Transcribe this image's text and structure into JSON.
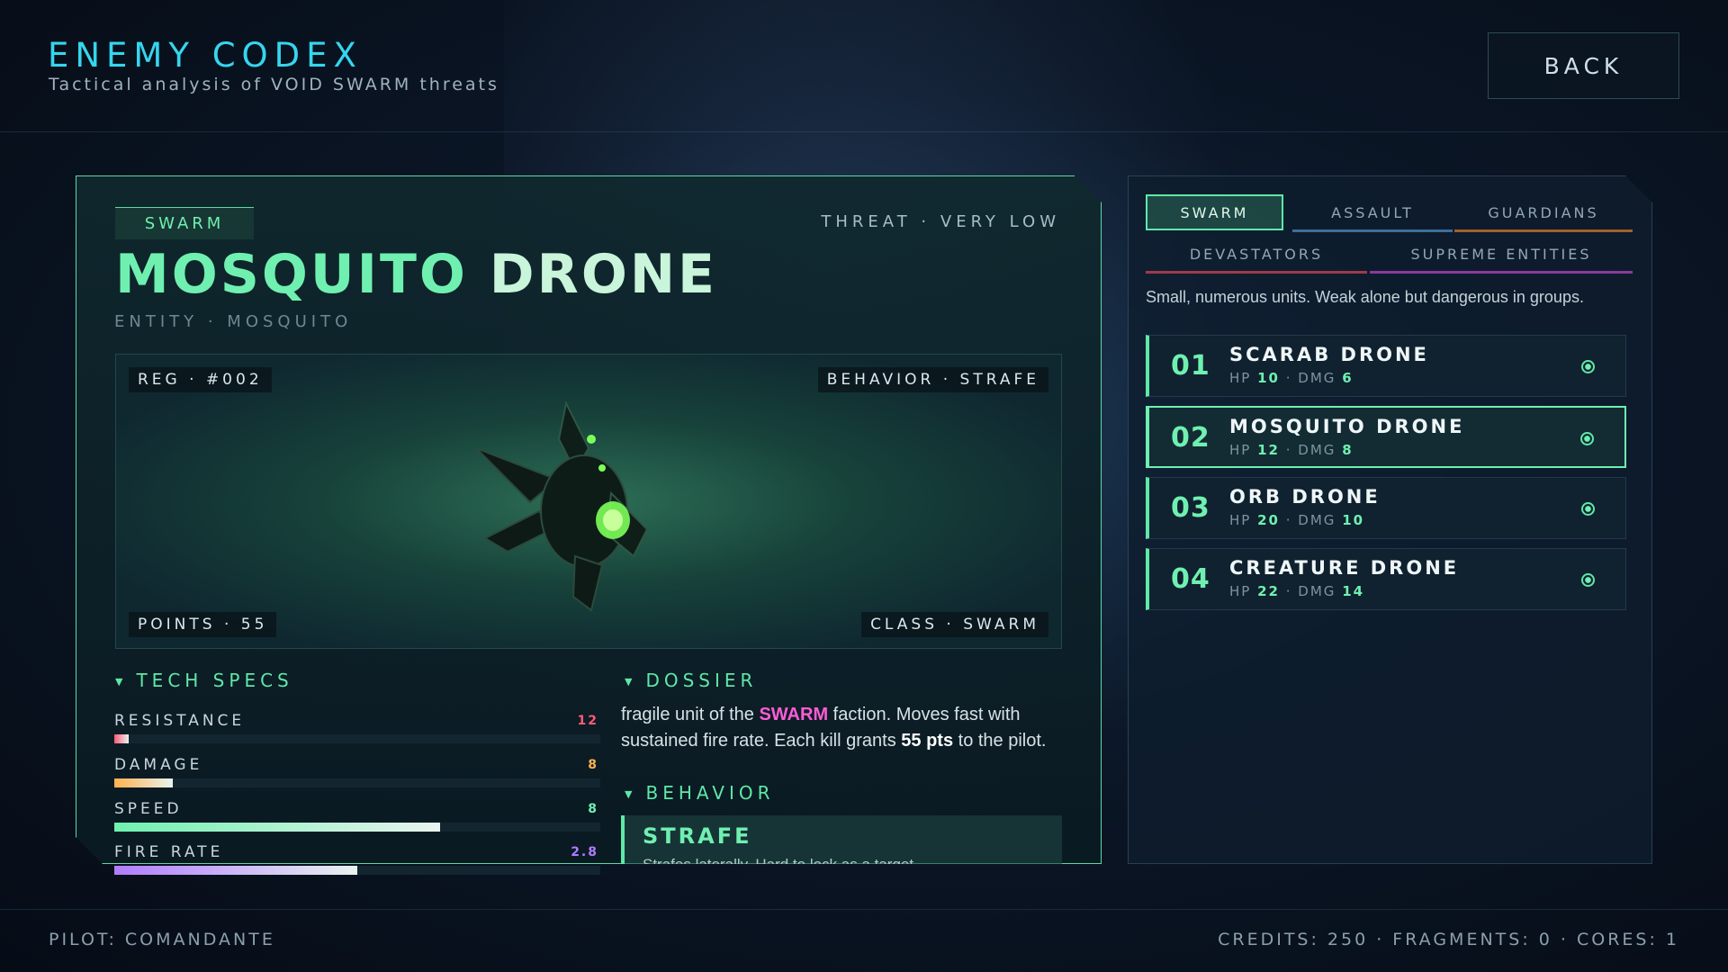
{
  "header": {
    "title": "ENEMY CODEX",
    "subtitle": "Tactical analysis of VOID SWARM threats",
    "back_label": "BACK"
  },
  "detail": {
    "faction": "SWARM",
    "threat": "THREAT · VERY LOW",
    "name_first": "MOSQUITO",
    "name_rest": " DRONE",
    "entity": "ENTITY · MOSQUITO",
    "viewer": {
      "reg": "REG · #002",
      "behavior": "BEHAVIOR · STRAFE",
      "points": "POINTS · 55",
      "class": "CLASS · SWARM"
    },
    "tech_specs_title": "TECH SPECS",
    "stats": [
      {
        "label": "RESISTANCE",
        "value": "12",
        "fill": 0.03,
        "color": "#ff5a7a"
      },
      {
        "label": "DAMAGE",
        "value": "8",
        "fill": 0.12,
        "color": "#ffb24d"
      },
      {
        "label": "SPEED",
        "value": "8",
        "fill": 0.67,
        "color": "#6ff0b0"
      },
      {
        "label": "FIRE RATE",
        "value": "2.8",
        "fill": 0.5,
        "color": "#b07cff"
      }
    ],
    "dossier_title": "DOSSIER",
    "dossier": {
      "part1": "fragile unit of the ",
      "faction": "SWARM",
      "part2": " faction. Moves fast with sustained fire rate. Each kill grants ",
      "points": "55 pts",
      "part3": " to the pilot."
    },
    "behavior_title": "BEHAVIOR",
    "behavior_name": "STRAFE",
    "behavior_desc": "Strafes laterally. Hard to lock as a target."
  },
  "roster": {
    "tabs": [
      {
        "label": "SWARM",
        "active": true,
        "color": "#5fe8a8"
      },
      {
        "label": "ASSAULT",
        "active": false,
        "color": "#3d6f9a"
      },
      {
        "label": "GUARDIANS",
        "active": false,
        "color": "#a0612a"
      },
      {
        "label": "DEVASTATORS",
        "active": false,
        "color": "#a03a4a"
      },
      {
        "label": "SUPREME ENTITIES",
        "active": false,
        "color": "#8a3a9a"
      }
    ],
    "description": "Small, numerous units. Weak alone but dangerous in groups.",
    "enemies": [
      {
        "num": "01",
        "name": "SCARAB DRONE",
        "hp": "10",
        "dmg": "6",
        "selected": false
      },
      {
        "num": "02",
        "name": "MOSQUITO DRONE",
        "hp": "12",
        "dmg": "8",
        "selected": true
      },
      {
        "num": "03",
        "name": "ORB DRONE",
        "hp": "20",
        "dmg": "10",
        "selected": false
      },
      {
        "num": "04",
        "name": "CREATURE DRONE",
        "hp": "22",
        "dmg": "14",
        "selected": false
      }
    ],
    "hp_label": "HP",
    "dmg_label": "DMG"
  },
  "footer": {
    "pilot": "PILOT: COMANDANTE",
    "resources": "CREDITS: 250 · FRAGMENTS: 0 · CORES: 1"
  }
}
